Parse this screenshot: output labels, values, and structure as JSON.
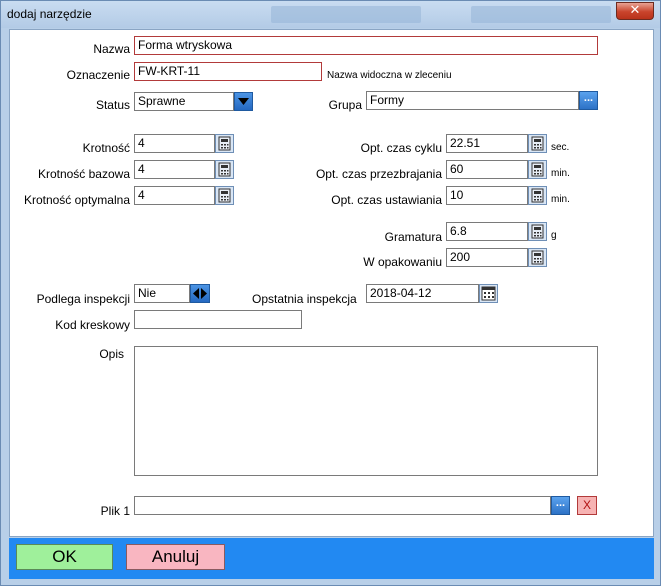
{
  "window": {
    "title": "dodaj narzędzie",
    "close_glyph": "✕"
  },
  "form": {
    "nazwa": {
      "label": "Nazwa",
      "value": "Forma wtryskowa"
    },
    "oznaczenie": {
      "label": "Oznaczenie",
      "value": "FW-KRT-11",
      "hint": "Nazwa widoczna w zleceniu"
    },
    "status": {
      "label": "Status",
      "value": "Sprawne"
    },
    "grupa": {
      "label": "Grupa",
      "value": "Formy",
      "button": "..."
    },
    "krotnosc": {
      "label": "Krotność",
      "value": "4"
    },
    "krotnosc_bazowa": {
      "label": "Krotność bazowa",
      "value": "4"
    },
    "krotnosc_optymalna": {
      "label": "Krotność optymalna",
      "value": "4"
    },
    "czas_cyklu": {
      "label": "Opt. czas cyklu",
      "value": "22.51",
      "unit": "sec."
    },
    "czas_przezbrajania": {
      "label": "Opt. czas przezbrajania",
      "value": "60",
      "unit": "min."
    },
    "czas_ustawiania": {
      "label": "Opt. czas ustawiania",
      "value": "10",
      "unit": "min."
    },
    "gramatura": {
      "label": "Gramatura",
      "value": "6.8",
      "unit": "g"
    },
    "w_opakowaniu": {
      "label": "W opakowaniu",
      "value": "200"
    },
    "podlega_inspekcji": {
      "label": "Podlega inspekcji",
      "value": "Nie"
    },
    "ostatnia_inspekcja": {
      "label": "Opstatnia inspekcja",
      "value": "2018-04-12"
    },
    "kod_kreskowy": {
      "label": "Kod kreskowy",
      "value": ""
    },
    "opis": {
      "label": "Opis",
      "value": ""
    },
    "plik1": {
      "label": "Plik 1",
      "value": "",
      "browse": "...",
      "clear": "X"
    }
  },
  "footer": {
    "ok": "OK",
    "cancel": "Anuluj"
  },
  "colors": {
    "footer": "#2289f2",
    "ok": "#9ff09b",
    "cancel": "#f9b6c1",
    "required_border": "#b23a3a"
  },
  "icons": {
    "calculator": "calculator-icon",
    "dropdown": "chevron-down-icon",
    "spinner": "left-right-arrows-icon",
    "calendar": "calendar-icon"
  }
}
